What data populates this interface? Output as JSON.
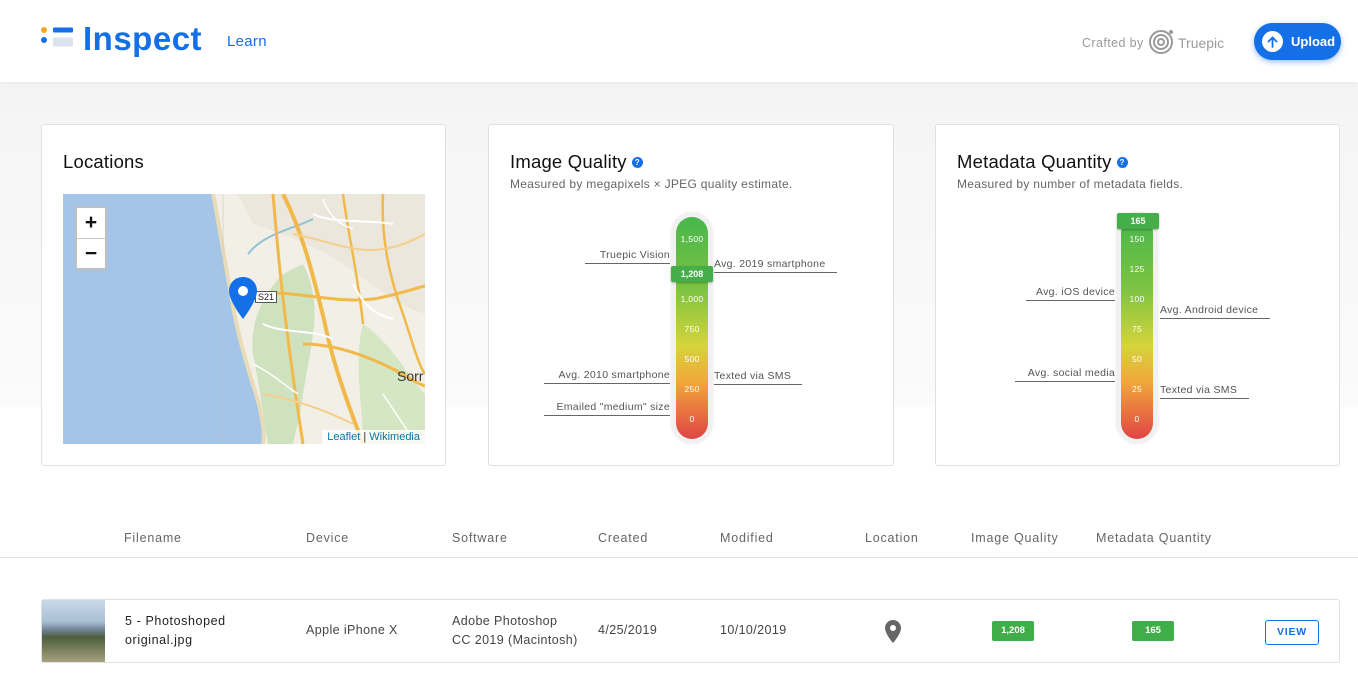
{
  "header": {
    "app_title": "Inspect",
    "learn_link": "Learn",
    "crafted_by": "Crafted by",
    "brand": "Truepic",
    "upload_label": "Upload"
  },
  "cards": {
    "locations": {
      "title": "Locations",
      "zoom_in": "+",
      "zoom_out": "−",
      "attribution_leaflet": "Leaflet",
      "attribution_sep": "|",
      "attribution_wikimedia": "Wikimedia",
      "road_badge": "S21",
      "city_label": "Sorr"
    },
    "image_quality": {
      "title": "Image Quality",
      "subtitle": "Measured by megapixels × JPEG quality estimate.",
      "ticks": [
        "1,500",
        "1,000",
        "750",
        "500",
        "250",
        "0"
      ],
      "marker_label": "1,208",
      "refs_left": [
        "Truepic Vision",
        "Avg. 2010 smartphone",
        "Emailed \"medium\" size"
      ],
      "refs_right": [
        "Avg. 2019 smartphone",
        "Texted via SMS"
      ]
    },
    "metadata_quantity": {
      "title": "Metadata Quantity",
      "subtitle": "Measured by number of metadata fields.",
      "ticks": [
        "150",
        "125",
        "100",
        "75",
        "50",
        "25",
        "0"
      ],
      "marker_label": "165",
      "refs_left": [
        "Avg. iOS device",
        "Avg. social media"
      ],
      "refs_right": [
        "Avg. Android device",
        "Texted via SMS"
      ]
    }
  },
  "table": {
    "columns": [
      "Filename",
      "Device",
      "Software",
      "Created",
      "Modified",
      "Location",
      "Image Quality",
      "Metadata Quantity"
    ],
    "rows": [
      {
        "filename_line1": "5 - Photoshoped",
        "filename_line2": "original.jpg",
        "device": "Apple iPhone X",
        "software_line1": "Adobe Photoshop",
        "software_line2": "CC 2019 (Macintosh)",
        "created": "4/25/2019",
        "modified": "10/10/2019",
        "image_quality": "1,208",
        "metadata_quantity": "165",
        "action": "VIEW"
      }
    ]
  },
  "colors": {
    "accent": "#1470e6",
    "score_green": "#3fae49"
  }
}
